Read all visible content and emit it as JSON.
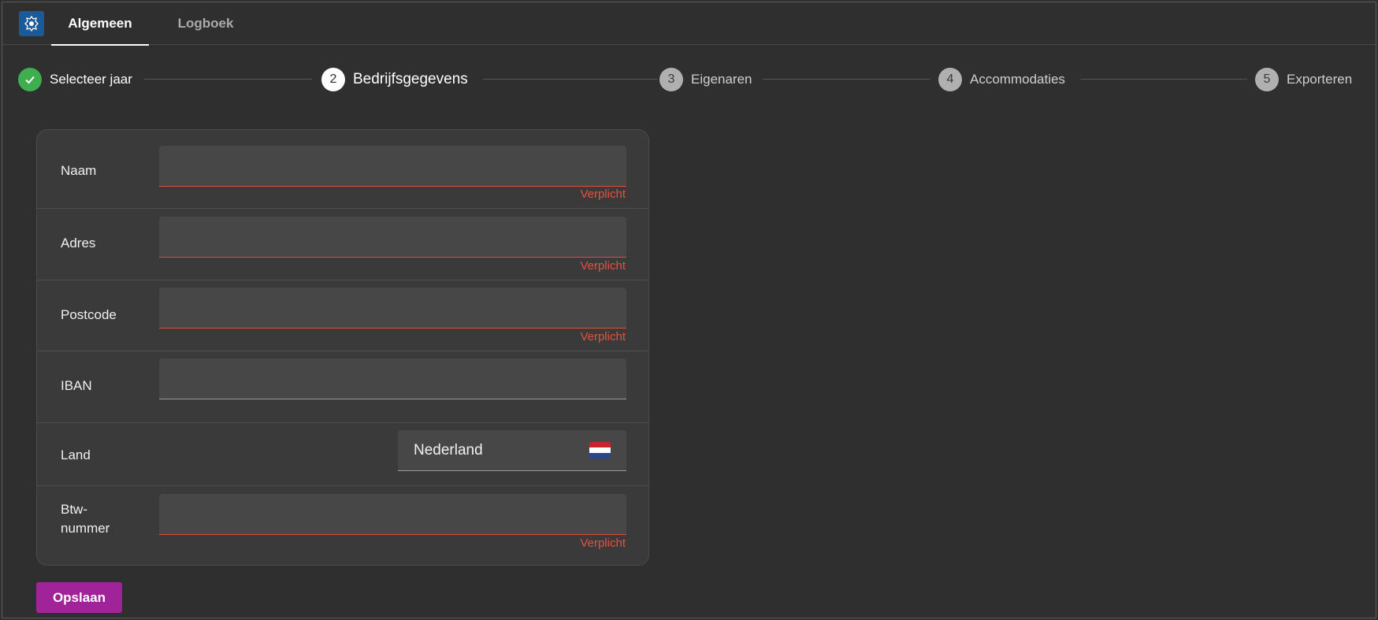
{
  "header": {
    "tabs": [
      {
        "label": "Algemeen",
        "active": true
      },
      {
        "label": "Logboek",
        "active": false
      }
    ]
  },
  "stepper": {
    "steps": [
      {
        "number": "",
        "label": "Selecteer jaar",
        "state": "done"
      },
      {
        "number": "2",
        "label": "Bedrijfsgegevens",
        "state": "current"
      },
      {
        "number": "3",
        "label": "Eigenaren",
        "state": "todo"
      },
      {
        "number": "4",
        "label": "Accommodaties",
        "state": "todo"
      },
      {
        "number": "5",
        "label": "Exporteren",
        "state": "todo"
      }
    ]
  },
  "form": {
    "fields": [
      {
        "label": "Naam",
        "value": "",
        "hint": "Verplicht"
      },
      {
        "label": "Adres",
        "value": "",
        "hint": "Verplicht"
      },
      {
        "label": "Postcode",
        "value": "",
        "hint": "Verplicht"
      },
      {
        "label": "IBAN",
        "value": "",
        "hint": ""
      },
      {
        "label": "Land",
        "value": "Nederland",
        "hint": ""
      },
      {
        "label": "Btw-\nnummer",
        "value": "",
        "hint": "Verplicht"
      }
    ]
  },
  "actions": {
    "save_label": "Opslaan"
  },
  "colors": {
    "background": "#2f2f2f",
    "card": "#3a3a3a",
    "error": "#e8503e",
    "success": "#3fae4f",
    "primary": "#a0239a"
  },
  "icons": {
    "logo": "crest-icon",
    "done": "check-icon",
    "flag": "netherlands-flag-icon"
  }
}
